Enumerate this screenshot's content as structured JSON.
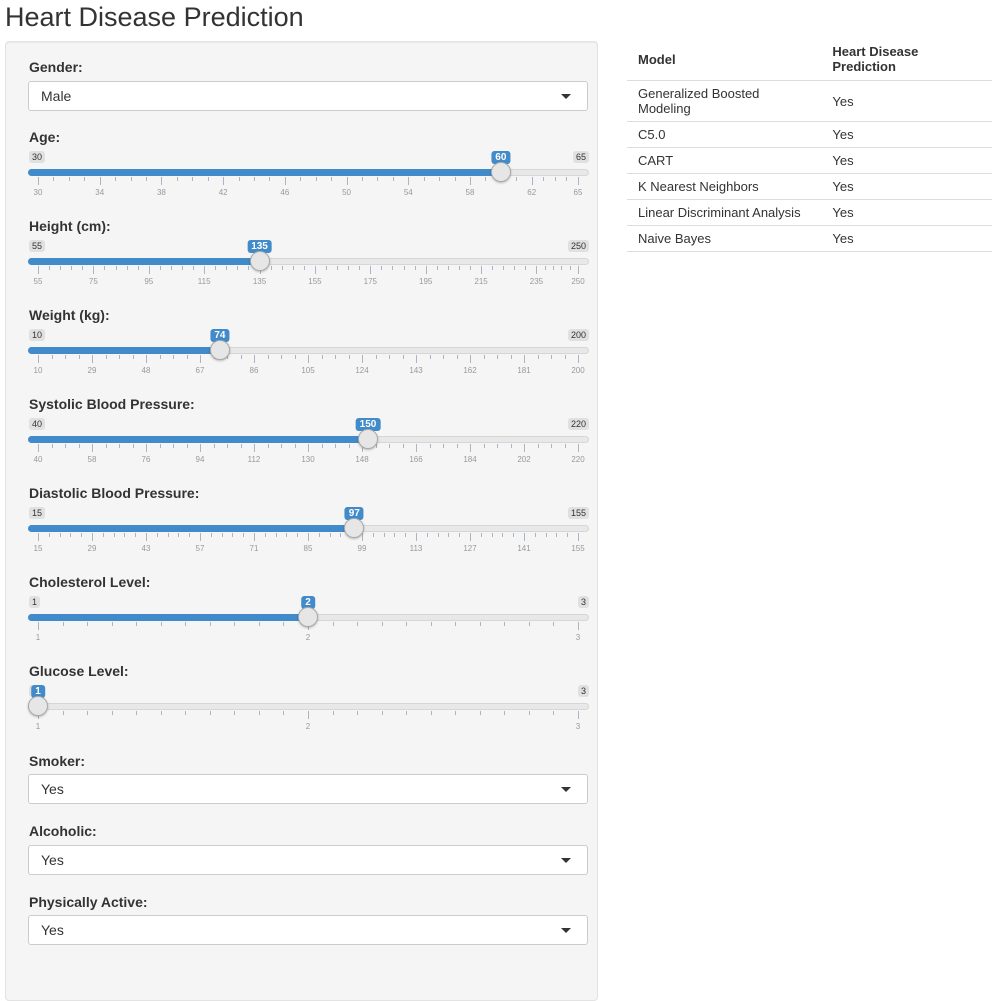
{
  "title": "Heart Disease Prediction",
  "gender": {
    "label": "Gender:",
    "value": "Male"
  },
  "sliders": [
    {
      "label": "Age:",
      "min": 30,
      "max": 65,
      "value": 60,
      "step": 4,
      "minor": 3
    },
    {
      "label": "Height (cm):",
      "min": 55,
      "max": 250,
      "value": 135,
      "step": 20,
      "minor": 4
    },
    {
      "label": "Weight (kg):",
      "min": 10,
      "max": 200,
      "value": 74,
      "step": 19,
      "minor": 3
    },
    {
      "label": "Systolic Blood Pressure:",
      "min": 40,
      "max": 220,
      "value": 150,
      "step": 18,
      "minor": 3
    },
    {
      "label": "Diastolic Blood Pressure:",
      "min": 15,
      "max": 155,
      "value": 97,
      "step": 14,
      "minor": 4
    },
    {
      "label": "Cholesterol Level:",
      "min": 1,
      "max": 3,
      "value": 2,
      "step": 1,
      "minor": 10
    },
    {
      "label": "Glucose Level:",
      "min": 1,
      "max": 3,
      "value": 1,
      "step": 1,
      "minor": 10
    }
  ],
  "smoker": {
    "label": "Smoker:",
    "value": "Yes"
  },
  "alcoholic": {
    "label": "Alcoholic:",
    "value": "Yes"
  },
  "active": {
    "label": "Physically Active:",
    "value": "Yes"
  },
  "results": {
    "headers": [
      "Model",
      "Heart Disease Prediction"
    ],
    "rows": [
      [
        "Generalized Boosted Modeling",
        "Yes"
      ],
      [
        "C5.0",
        "Yes"
      ],
      [
        "CART",
        "Yes"
      ],
      [
        "K Nearest Neighbors",
        "Yes"
      ],
      [
        "Linear Discriminant Analysis",
        "Yes"
      ],
      [
        "Naive Bayes",
        "Yes"
      ]
    ]
  },
  "colors": {
    "accent": "#428bca",
    "panel": "#f5f5f5"
  }
}
